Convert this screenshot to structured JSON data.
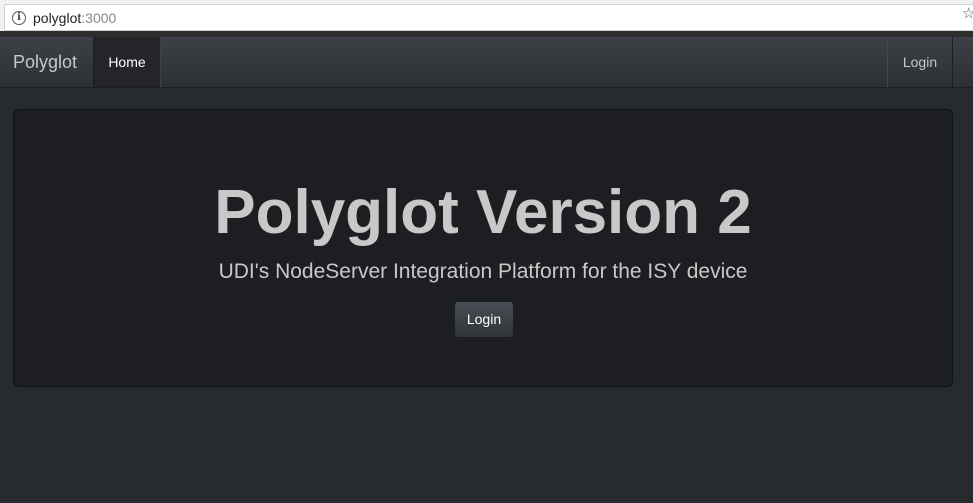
{
  "browser": {
    "url_host": "polyglot",
    "url_port": ":3000"
  },
  "navbar": {
    "brand": "Polyglot",
    "home_label": "Home",
    "login_label": "Login"
  },
  "jumbotron": {
    "title": "Polyglot Version 2",
    "subtitle": "UDI's NodeServer Integration Platform for the ISY device",
    "login_button": "Login"
  },
  "icons": {
    "info": "info-icon",
    "bookmark": "star-icon"
  },
  "colors": {
    "background": "#272b30",
    "navbar": "#3a3f44",
    "jumbotron": "#1c1e22",
    "text": "#c8c8c8"
  }
}
